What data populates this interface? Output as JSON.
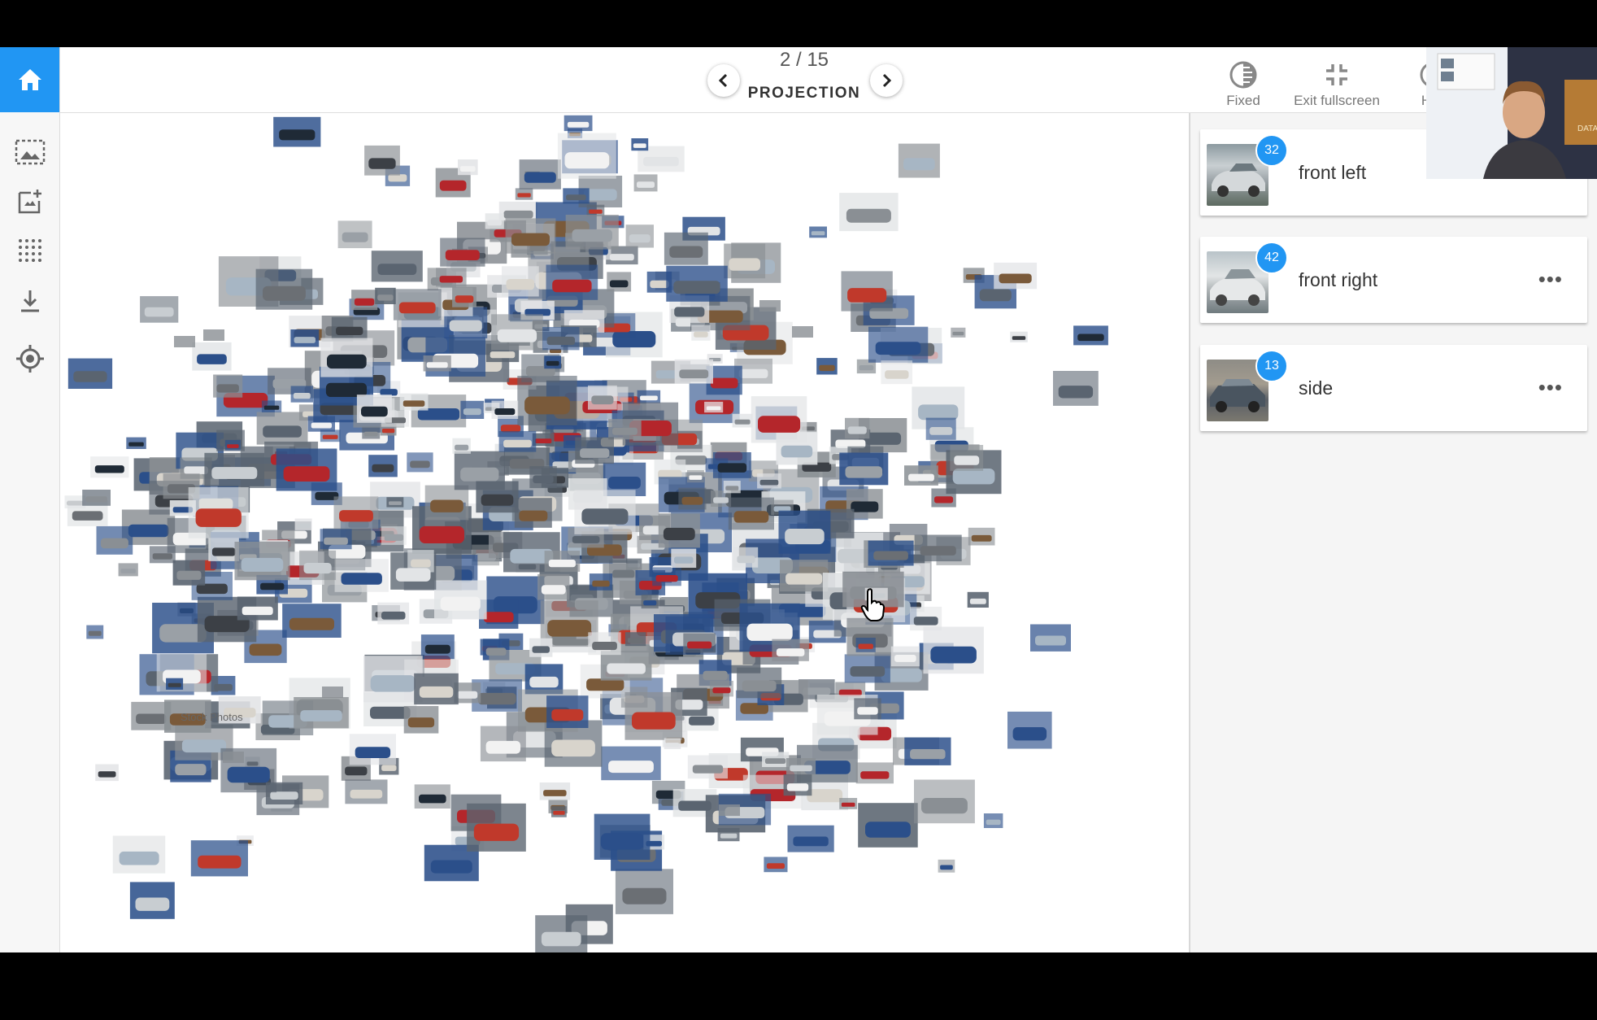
{
  "header": {
    "counter": "2 / 15",
    "section_title": "PROJECTION"
  },
  "rail": {
    "items": [
      "home-icon",
      "image-select-icon",
      "image-add-icon",
      "grid-icon",
      "download-icon",
      "target-icon"
    ]
  },
  "toolbar": {
    "fixed_label": "Fixed",
    "exit_fullscreen_label": "Exit fullscreen",
    "partial_label": "H"
  },
  "clusters": [
    {
      "label": "front left",
      "count": "32",
      "menu": ""
    },
    {
      "label": "front right",
      "count": "42",
      "menu": "•••"
    },
    {
      "label": "side",
      "count": "13",
      "menu": "•••"
    }
  ],
  "watermark": "Stock Photos",
  "webcam_sign": "DATA INSTITUTE",
  "colors": {
    "accent": "#2196f3",
    "rail_background": "#f7f7f7",
    "panel_background": "#f5f5f5"
  }
}
